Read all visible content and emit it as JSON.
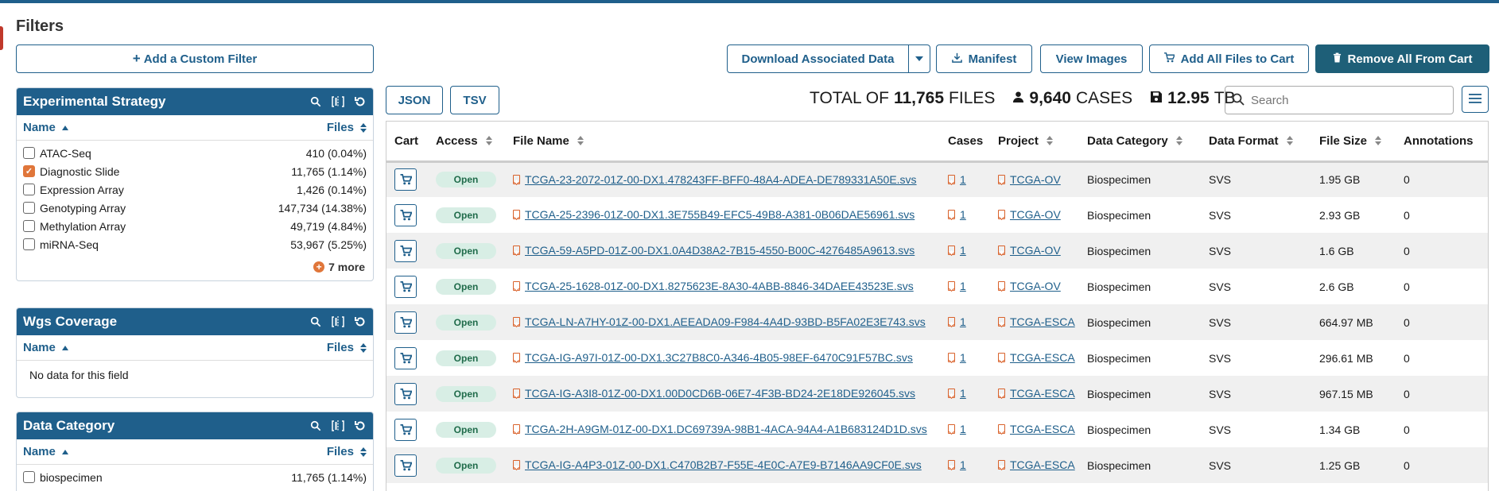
{
  "colors": {
    "primary": "#1f5f8b",
    "dark_button": "#1e5f78",
    "accent_orange": "#e0763a",
    "open_badge_bg": "#d8eee5"
  },
  "filters": {
    "title": "Filters",
    "add_filter_label": "Add a Custom Filter",
    "facets": [
      {
        "title": "Experimental Strategy",
        "name_col": "Name",
        "files_col": "Files",
        "items": [
          {
            "label": "ATAC-Seq",
            "count": "410 (0.04%)",
            "checked": false
          },
          {
            "label": "Diagnostic Slide",
            "count": "11,765 (1.14%)",
            "checked": true
          },
          {
            "label": "Expression Array",
            "count": "1,426 (0.14%)",
            "checked": false
          },
          {
            "label": "Genotyping Array",
            "count": "147,734 (14.38%)",
            "checked": false
          },
          {
            "label": "Methylation Array",
            "count": "49,719 (4.84%)",
            "checked": false
          },
          {
            "label": "miRNA-Seq",
            "count": "53,967 (5.25%)",
            "checked": false
          }
        ],
        "more_label": "7 more"
      },
      {
        "title": "Wgs Coverage",
        "name_col": "Name",
        "files_col": "Files",
        "no_data": "No data for this field"
      },
      {
        "title": "Data Category",
        "name_col": "Name",
        "files_col": "Files",
        "items": [
          {
            "label": "biospecimen",
            "count": "11,765 (1.14%)",
            "checked": false
          }
        ]
      }
    ]
  },
  "actions": {
    "download_associated": "Download Associated Data",
    "manifest": "Manifest",
    "view_images": "View Images",
    "add_all_to_cart": "Add All Files to Cart",
    "remove_all_from_cart": "Remove All From Cart",
    "json": "JSON",
    "tsv": "TSV"
  },
  "totals": {
    "prefix": "TOTAL OF",
    "files_count": "11,765",
    "files_label": "FILES",
    "cases_count": "9,640",
    "cases_label": "CASES",
    "size": "12.95",
    "size_unit": "TB"
  },
  "search": {
    "placeholder": "Search"
  },
  "table": {
    "columns": [
      "Cart",
      "Access",
      "File Name",
      "Cases",
      "Project",
      "Data Category",
      "Data Format",
      "File Size",
      "Annotations"
    ],
    "rows": [
      {
        "access": "Open",
        "file_name": "TCGA-23-2072-01Z-00-DX1.478243FF-BFF0-48A4-ADEA-DE789331A50E.svs",
        "cases": "1",
        "project": "TCGA-OV",
        "data_category": "Biospecimen",
        "data_format": "SVS",
        "file_size": "1.95 GB",
        "annotations": "0"
      },
      {
        "access": "Open",
        "file_name": "TCGA-25-2396-01Z-00-DX1.3E755B49-EFC5-49B8-A381-0B06DAE56961.svs",
        "cases": "1",
        "project": "TCGA-OV",
        "data_category": "Biospecimen",
        "data_format": "SVS",
        "file_size": "2.93 GB",
        "annotations": "0"
      },
      {
        "access": "Open",
        "file_name": "TCGA-59-A5PD-01Z-00-DX1.0A4D38A2-7B15-4550-B00C-4276485A9613.svs",
        "cases": "1",
        "project": "TCGA-OV",
        "data_category": "Biospecimen",
        "data_format": "SVS",
        "file_size": "1.6 GB",
        "annotations": "0"
      },
      {
        "access": "Open",
        "file_name": "TCGA-25-1628-01Z-00-DX1.8275623E-8A30-4ABB-8846-34DAEE43523E.svs",
        "cases": "1",
        "project": "TCGA-OV",
        "data_category": "Biospecimen",
        "data_format": "SVS",
        "file_size": "2.6 GB",
        "annotations": "0"
      },
      {
        "access": "Open",
        "file_name": "TCGA-LN-A7HY-01Z-00-DX1.AEEADA09-F984-4A4D-93BD-B5FA02E3E743.svs",
        "cases": "1",
        "project": "TCGA-ESCA",
        "data_category": "Biospecimen",
        "data_format": "SVS",
        "file_size": "664.97 MB",
        "annotations": "0"
      },
      {
        "access": "Open",
        "file_name": "TCGA-IG-A97I-01Z-00-DX1.3C27B8C0-A346-4B05-98EF-6470C91F57BC.svs",
        "cases": "1",
        "project": "TCGA-ESCA",
        "data_category": "Biospecimen",
        "data_format": "SVS",
        "file_size": "296.61 MB",
        "annotations": "0"
      },
      {
        "access": "Open",
        "file_name": "TCGA-IG-A3I8-01Z-00-DX1.00D0CD6B-06E7-4F3B-BD24-2E18DE926045.svs",
        "cases": "1",
        "project": "TCGA-ESCA",
        "data_category": "Biospecimen",
        "data_format": "SVS",
        "file_size": "967.15 MB",
        "annotations": "0"
      },
      {
        "access": "Open",
        "file_name": "TCGA-2H-A9GM-01Z-00-DX1.DC69739A-98B1-4ACA-94A4-A1B683124D1D.svs",
        "cases": "1",
        "project": "TCGA-ESCA",
        "data_category": "Biospecimen",
        "data_format": "SVS",
        "file_size": "1.34 GB",
        "annotations": "0"
      },
      {
        "access": "Open",
        "file_name": "TCGA-IG-A4P3-01Z-00-DX1.C470B2B7-F55E-4E0C-A7E9-B7146AA9CF0E.svs",
        "cases": "1",
        "project": "TCGA-ESCA",
        "data_category": "Biospecimen",
        "data_format": "SVS",
        "file_size": "1.25 GB",
        "annotations": "0"
      }
    ]
  }
}
